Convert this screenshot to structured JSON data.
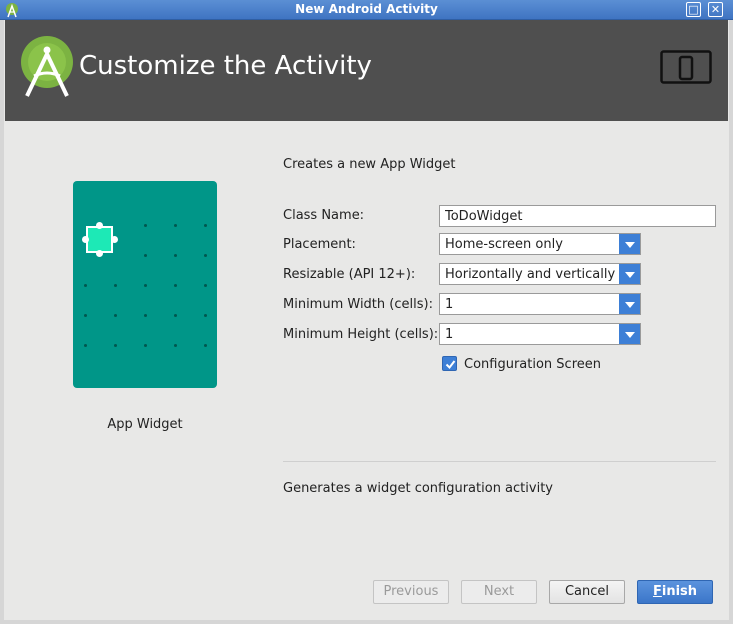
{
  "window": {
    "title": "New Android Activity"
  },
  "header": {
    "heading": "Customize the Activity"
  },
  "preview": {
    "caption": "App Widget"
  },
  "form": {
    "description": "Creates a new App Widget",
    "class_name": {
      "label": "Class Name:",
      "value": "ToDoWidget"
    },
    "placement": {
      "label": "Placement:",
      "value": "Home-screen only"
    },
    "resizable": {
      "label": "Resizable (API 12+):",
      "value": "Horizontally and vertically"
    },
    "min_width": {
      "label": "Minimum Width (cells):",
      "value": "1"
    },
    "min_height": {
      "label": "Minimum Height (cells):",
      "value": "1"
    },
    "config_screen": {
      "label": "Configuration Screen",
      "checked": true
    },
    "help_text": "Generates a widget configuration activity"
  },
  "buttons": {
    "previous": "Previous",
    "next": "Next",
    "cancel": "Cancel",
    "finish_mnemonic": "F",
    "finish_rest": "inish"
  },
  "colors": {
    "accent": "#3d7fd6",
    "header_bg": "#4f4f4f",
    "preview_bg": "#009688",
    "widget_fill": "#1de9b6"
  }
}
